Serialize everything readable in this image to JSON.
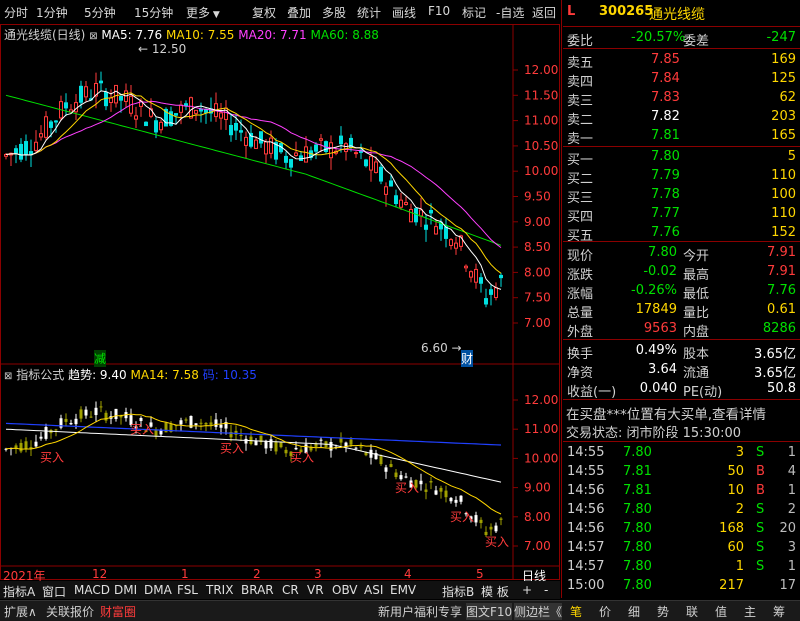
{
  "toolbar": {
    "left": [
      "分时",
      "1分钟",
      "5分钟",
      "15分钟",
      "更多"
    ],
    "right": [
      "复权",
      "叠加",
      "多股",
      "统计",
      "画线",
      "F10",
      "标记",
      "-自选",
      "返回"
    ]
  },
  "main_chart": {
    "title": "通光线缆(日线)",
    "ma": [
      {
        "label": "MA5: 7.76",
        "color": "#ffffff"
      },
      {
        "label": "MA10: 7.55",
        "color": "#ffd700"
      },
      {
        "label": "MA20: 7.71",
        "color": "#ff40ff"
      },
      {
        "label": "MA60: 8.88",
        "color": "#00e000"
      }
    ],
    "high_label": "12.50",
    "low_label": "6.60",
    "y_ticks": [
      "12.00",
      "11.50",
      "11.00",
      "10.50",
      "10.00",
      "9.50",
      "9.00",
      "8.50",
      "8.00",
      "7.50",
      "7.00"
    ],
    "marker_jian": "减",
    "marker_cai": "财"
  },
  "indicator": {
    "title": "指标公式",
    "trend_label": "趋势: 9.40",
    "ma14_label": "MA14: 7.58",
    "code_label": "码: 10.35",
    "buy_label": "买入",
    "y_ticks": [
      "12.00",
      "11.00",
      "10.00",
      "9.00",
      "8.00",
      "7.00"
    ]
  },
  "time_axis": {
    "labels": [
      "2021年",
      "12",
      "1",
      "2",
      "3",
      "4",
      "5"
    ],
    "period": "日线"
  },
  "bottom_tabs": [
    "指标A",
    "窗口",
    "MACD",
    "DMI",
    "DMA",
    "FSL",
    "TRIX",
    "BRAR",
    "CR",
    "VR",
    "OBV",
    "ASI",
    "EMV",
    "指标B",
    "模 板",
    "+",
    "-"
  ],
  "footer": {
    "items": [
      "扩展∧",
      "关联报价",
      "财富圈"
    ],
    "right_items": [
      "新用户福利专享",
      "图文F10",
      "侧边栏《"
    ],
    "icons": [
      "笔",
      "价",
      "细",
      "势",
      "联",
      "值",
      "主",
      "筹"
    ]
  },
  "quote": {
    "flag": "L",
    "code": "300265",
    "name": "通光线缆",
    "weibi_label": "委比",
    "weibi": "-20.57%",
    "weicha_label": "委差",
    "weicha": "-247",
    "asks": [
      {
        "label": "卖五",
        "price": "7.85",
        "vol": "169"
      },
      {
        "label": "卖四",
        "price": "7.84",
        "vol": "125"
      },
      {
        "label": "卖三",
        "price": "7.83",
        "vol": "62"
      },
      {
        "label": "卖二",
        "price": "7.82",
        "vol": "203"
      },
      {
        "label": "卖一",
        "price": "7.81",
        "vol": "165"
      }
    ],
    "bids": [
      {
        "label": "买一",
        "price": "7.80",
        "vol": "5"
      },
      {
        "label": "买二",
        "price": "7.79",
        "vol": "110"
      },
      {
        "label": "买三",
        "price": "7.78",
        "vol": "100"
      },
      {
        "label": "买四",
        "price": "7.77",
        "vol": "110"
      },
      {
        "label": "买五",
        "price": "7.76",
        "vol": "152"
      }
    ],
    "stats": [
      {
        "l1": "现价",
        "v1": "7.80",
        "l2": "今开",
        "v2": "7.91"
      },
      {
        "l1": "涨跌",
        "v1": "-0.02",
        "l2": "最高",
        "v2": "7.91"
      },
      {
        "l1": "涨幅",
        "v1": "-0.26%",
        "l2": "最低",
        "v2": "7.76"
      },
      {
        "l1": "总量",
        "v1": "17849",
        "l2": "量比",
        "v2": "0.61"
      },
      {
        "l1": "外盘",
        "v1": "9563",
        "l2": "内盘",
        "v2": "8286"
      }
    ],
    "stats2": [
      {
        "l1": "换手",
        "v1": "0.49%",
        "l2": "股本",
        "v2": "3.65亿"
      },
      {
        "l1": "净资",
        "v1": "3.64",
        "l2": "流通",
        "v2": "3.65亿"
      },
      {
        "l1": "收益(一)",
        "v1": "0.040",
        "l2": "PE(动)",
        "v2": "50.8"
      }
    ],
    "notice": "在买盘***位置有大买单,查看详情",
    "status": "交易状态: 闭市阶段 15:30:00",
    "trades": [
      {
        "t": "14:55",
        "p": "7.80",
        "v": "3",
        "s": "S",
        "n": "1"
      },
      {
        "t": "14:55",
        "p": "7.81",
        "v": "50",
        "s": "B",
        "n": "4"
      },
      {
        "t": "14:56",
        "p": "7.81",
        "v": "10",
        "s": "B",
        "n": "1"
      },
      {
        "t": "14:56",
        "p": "7.80",
        "v": "2",
        "s": "S",
        "n": "2"
      },
      {
        "t": "14:56",
        "p": "7.80",
        "v": "168",
        "s": "S",
        "n": "20"
      },
      {
        "t": "14:57",
        "p": "7.80",
        "v": "60",
        "s": "S",
        "n": "3"
      },
      {
        "t": "14:57",
        "p": "7.80",
        "v": "1",
        "s": "S",
        "n": "1"
      },
      {
        "t": "15:00",
        "p": "7.80",
        "v": "217",
        "s": "",
        "n": "17"
      }
    ]
  },
  "colors": {
    "up": "#ff3b3b",
    "down": "#00e0e0",
    "ma5": "#ffffff",
    "ma10": "#ffd700",
    "ma20": "#ff40ff",
    "ma60": "#00e000",
    "border": "#8b0000"
  }
}
